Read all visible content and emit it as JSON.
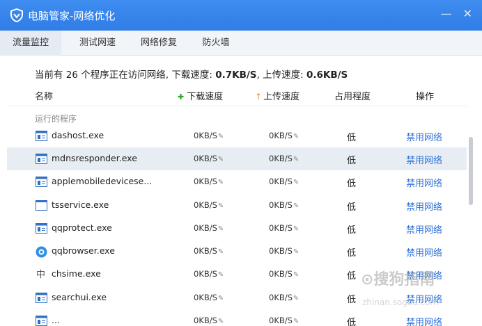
{
  "window": {
    "title": "电脑管家-网络优化",
    "controls": [
      "—",
      "✕"
    ]
  },
  "tabs": [
    {
      "label": "流量监控",
      "active": true
    },
    {
      "label": "测试网速",
      "active": false
    },
    {
      "label": "网络修复",
      "active": false
    },
    {
      "label": "防火墙",
      "active": false
    }
  ],
  "summary": {
    "prefix": "当前有 26 个程序正在访问网络, 下载速度: ",
    "download": "0.7KB/S",
    "middle": ", 上传速度: ",
    "upload": "0.6KB/S"
  },
  "columns": {
    "name": "名称",
    "download": "下载速度",
    "upload": "上传速度",
    "usage": "占用程度",
    "action": "操作"
  },
  "group_label": "运行的程序",
  "rows": [
    {
      "name": "dashost.exe",
      "download": "0KB/S",
      "upload": "0KB/S",
      "usage": "低",
      "action": "禁用网络",
      "icon": "window-icon"
    },
    {
      "name": "mdnsresponder.exe",
      "download": "0KB/S",
      "upload": "0KB/S",
      "usage": "低",
      "action": "禁用网络",
      "icon": "window-icon"
    },
    {
      "name": "applemobiledevicese...",
      "download": "0KB/S",
      "upload": "0KB/S",
      "usage": "低",
      "action": "禁用网络",
      "icon": "window-icon"
    },
    {
      "name": "tsservice.exe",
      "download": "0KB/S",
      "upload": "0KB/S",
      "usage": "低",
      "action": "禁用网络",
      "icon": "blank-window-icon"
    },
    {
      "name": "qqprotect.exe",
      "download": "0KB/S",
      "upload": "0KB/S",
      "usage": "低",
      "action": "禁用网络",
      "icon": "window-icon"
    },
    {
      "name": "qqbrowser.exe",
      "download": "0KB/S",
      "upload": "0KB/S",
      "usage": "低",
      "action": "禁用网络",
      "icon": "qqbrowser-icon"
    },
    {
      "name": "chsime.exe",
      "download": "0KB/S",
      "upload": "0KB/S",
      "usage": "低",
      "action": "禁用网络",
      "icon": "ime-icon"
    },
    {
      "name": "searchui.exe",
      "download": "0KB/S",
      "upload": "0KB/S",
      "usage": "低",
      "action": "禁用网络",
      "icon": "window-icon"
    },
    {
      "name": "...",
      "download": "0KB/S",
      "upload": "0KB/S",
      "usage": "低",
      "action": "禁用网络",
      "icon": "window-icon"
    }
  ],
  "watermark": {
    "main": "⊙搜狗指南",
    "sub": "zhinan.sogou.com"
  },
  "colors": {
    "titlebar": "#2f7de6",
    "link": "#2f72d8",
    "highlight_row": "#e8edf4"
  }
}
